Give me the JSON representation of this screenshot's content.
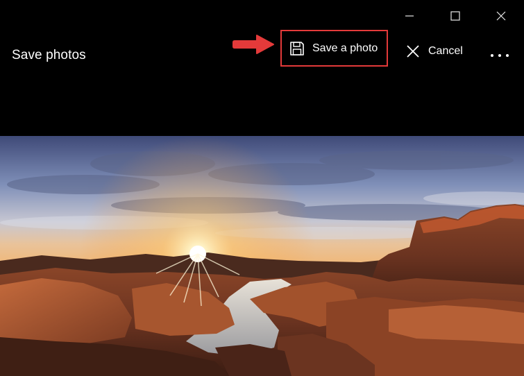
{
  "window": {
    "controls": {
      "minimize_icon": "minimize-icon",
      "maximize_icon": "maximize-icon",
      "close_icon": "close-icon"
    }
  },
  "commandbar": {
    "title": "Save photos",
    "save_label": "Save a photo",
    "save_icon": "floppy-disk-icon",
    "cancel_label": "Cancel",
    "cancel_icon": "x-icon",
    "more_icon": "more-ellipsis-icon"
  },
  "annotation": {
    "arrow_color": "#e43a3a",
    "highlight_color": "#e43a3a"
  },
  "photo": {
    "subject": "canyon-sunset-landscape"
  }
}
